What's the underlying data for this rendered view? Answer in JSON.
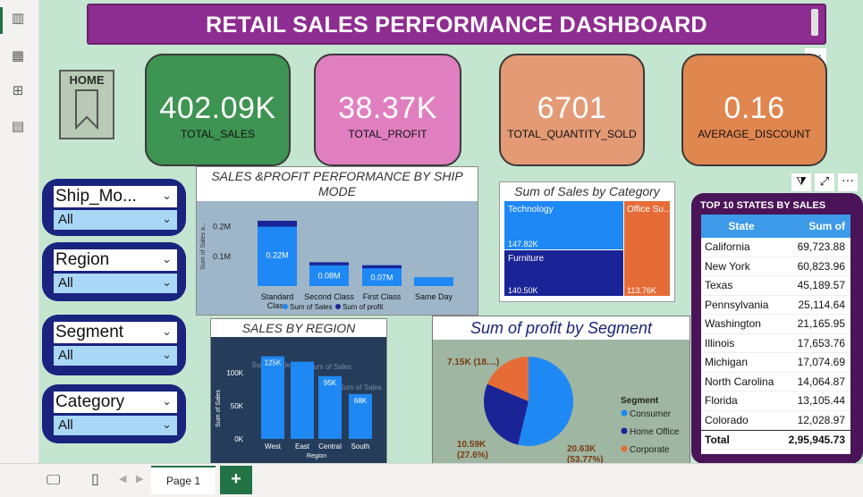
{
  "dashboard": {
    "title": "RETAIL SALES PERFORMANCE DASHBOARD",
    "home_label": "HOME",
    "more_label": "···"
  },
  "left_rail": {
    "icons": [
      "report-view-icon",
      "table-view-icon",
      "model-view-icon",
      "dax-query-icon"
    ]
  },
  "kpis": [
    {
      "value": "402.09K",
      "label": "TOTAL_SALES",
      "color": "#3e9452"
    },
    {
      "value": "38.37K",
      "label": "TOTAL_PROFIT",
      "color": "#e07fc0"
    },
    {
      "value": "6701",
      "label": "TOTAL_QUANTITY_SOLD",
      "color": "#e39a75"
    },
    {
      "value": "0.16",
      "label": "AVERAGE_DISCOUNT",
      "color": "#e0864f"
    }
  ],
  "slicers": [
    {
      "title": "Ship_Mo...",
      "value": "All"
    },
    {
      "title": "Region",
      "value": "All"
    },
    {
      "title": "Segment",
      "value": "All"
    },
    {
      "title": "Category",
      "value": "All"
    }
  ],
  "chart_data": [
    {
      "type": "bar",
      "title": "SALES &PROFIT PERFORMANCE BY SHIP MODE",
      "ylabel": "Sum of Sales a...",
      "categories": [
        "Standard Class",
        "Second Class",
        "First Class",
        "Same Day"
      ],
      "series": [
        {
          "name": "Sum of Sales",
          "values": [
            0.22,
            0.08,
            0.07,
            0.03
          ],
          "labels": [
            "0.22M",
            "0.08M",
            "0.07M",
            ""
          ]
        },
        {
          "name": "Sum of profit",
          "values": [
            0.02,
            0.01,
            0.01,
            0.0
          ]
        }
      ],
      "yticks": [
        "0.1M",
        "0.2M"
      ],
      "ylim": [
        0,
        0.25
      ],
      "legend": [
        "Sum of Sales",
        "Sum of profit"
      ]
    },
    {
      "type": "treemap",
      "title": "Sum of Sales by Category",
      "items": [
        {
          "name": "Technology",
          "value": "147.82K",
          "color": "#1e88f5"
        },
        {
          "name": "Furniture",
          "value": "140.50K",
          "color": "#1a2496"
        },
        {
          "name": "Office Su...",
          "value": "113.76K",
          "color": "#e66c37"
        }
      ]
    },
    {
      "type": "bar",
      "title": "SALES BY REGION",
      "xlabel": "Region",
      "ylabel": "Sum of Sales",
      "categories": [
        "West",
        "East",
        "Central",
        "South"
      ],
      "values": [
        125,
        117,
        95,
        68
      ],
      "labels": [
        "125K",
        "",
        "95K",
        "68K"
      ],
      "yticks": [
        "0K",
        "50K",
        "100K"
      ],
      "ylim": [
        0,
        130
      ],
      "ghost_labels": [
        "Sum of Sales",
        "Sum of Sales",
        "Sum of Sales"
      ]
    },
    {
      "type": "pie",
      "title": "Sum of profit by Segment",
      "legend_title": "Segment",
      "slices": [
        {
          "name": "Consumer",
          "value": 20.63,
          "label": "20.63K\n(53.77%)",
          "color": "#1e88f5"
        },
        {
          "name": "Home Office",
          "value": 10.59,
          "label": "10.59K\n(27.6%)",
          "color": "#1a2496"
        },
        {
          "name": "Corporate",
          "value": 7.15,
          "label": "7.15K (18....)",
          "color": "#e66c37"
        }
      ]
    }
  ],
  "top10": {
    "title": "TOP 10 STATES BY SALES",
    "headers": [
      "State",
      "Sum of Sales"
    ],
    "rows": [
      [
        "California",
        "69,723.88"
      ],
      [
        "New York",
        "60,823.96"
      ],
      [
        "Texas",
        "45,189.57"
      ],
      [
        "Pennsylvania",
        "25,114.64"
      ],
      [
        "Washington",
        "21,165.95"
      ],
      [
        "Illinois",
        "17,653.76"
      ],
      [
        "Michigan",
        "17,074.69"
      ],
      [
        "North Carolina",
        "14,064.87"
      ],
      [
        "Florida",
        "13,105.44"
      ],
      [
        "Colorado",
        "12,028.97"
      ]
    ],
    "total_label": "Total",
    "total_value": "2,95,945.73"
  },
  "bottom": {
    "page_tab": "Page 1",
    "add_label": "+"
  }
}
